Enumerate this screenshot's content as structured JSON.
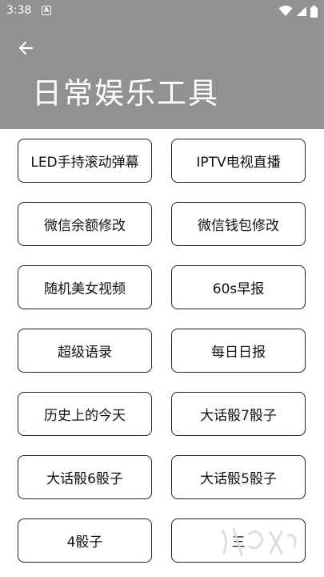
{
  "status_bar": {
    "time": "3:38",
    "notification_letter": "A"
  },
  "header": {
    "title": "日常娱乐工具",
    "background": "#919191"
  },
  "grid": {
    "items": [
      {
        "label": "LED手持滚动弹幕"
      },
      {
        "label": "IPTV电视直播"
      },
      {
        "label": "微信余额修改"
      },
      {
        "label": "微信钱包修改"
      },
      {
        "label": "随机美女视频"
      },
      {
        "label": "60s早报"
      },
      {
        "label": "超级语录"
      },
      {
        "label": "每日日报"
      },
      {
        "label": "历史上的今天"
      },
      {
        "label": "大话骰7骰子"
      },
      {
        "label": "大话骰6骰子"
      },
      {
        "label": "大话骰5骰子"
      },
      {
        "label": "4骰子"
      },
      {
        "label": "三"
      }
    ]
  }
}
